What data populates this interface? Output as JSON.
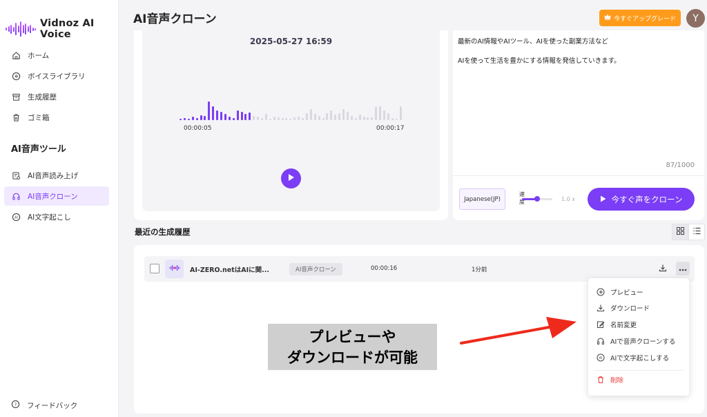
{
  "app": {
    "name": "Vidnoz AI Voice"
  },
  "sidebar": {
    "items": [
      {
        "label": "ホーム",
        "icon": "home-icon"
      },
      {
        "label": "ボイスライブラリ",
        "icon": "voice-library-icon"
      },
      {
        "label": "生成履歴",
        "icon": "history-icon"
      },
      {
        "label": "ゴミ箱",
        "icon": "trash-icon"
      }
    ],
    "section_title": "AI音声ツール",
    "tools": [
      {
        "label": "AI音声読み上げ",
        "icon": "text-to-speech-icon"
      },
      {
        "label": "AI音声クローン",
        "icon": "voice-clone-icon",
        "active": true
      },
      {
        "label": "AI文字起こし",
        "icon": "transcribe-icon"
      }
    ],
    "feedback_label": "フィードバック"
  },
  "header": {
    "title": "AI音声クローン",
    "upgrade_label": "今すぐアップグレード",
    "avatar_initial": "Y"
  },
  "player": {
    "date": "2025-05-27 16:59",
    "time_start": "00:00:05",
    "time_end": "00:00:17",
    "progress": 0.32,
    "played_color": "#7b3df5",
    "unplayed_color": "#d8d8e0"
  },
  "text_panel": {
    "lines": [
      "最新のAI情報やAIツール、AIを使った副業方法など",
      "AIを使って生活を豊かにする情報を発信していきます。"
    ],
    "char_count": "87/1000"
  },
  "controls": {
    "language": "Japanese(JP)",
    "speed_label": "速度",
    "speed_value": "1.0 x",
    "speed_level": 0.5,
    "clone_button_label": "今すぐ声をクローン"
  },
  "history": {
    "title": "最近の生成履歴",
    "rows": [
      {
        "name": "AI-ZERO.netはAIに関...",
        "tag": "AI音声クローン",
        "duration": "00:00:16",
        "time_ago": "1分前"
      }
    ]
  },
  "menu": {
    "items": [
      {
        "label": "プレビュー",
        "icon": "preview-icon"
      },
      {
        "label": "ダウンロード",
        "icon": "download-icon"
      },
      {
        "label": "名前変更",
        "icon": "rename-icon"
      },
      {
        "label": "AIで音声クローンする",
        "icon": "voice-clone-icon"
      },
      {
        "label": "AIで文字起こしする",
        "icon": "transcribe-icon"
      }
    ],
    "delete_label": "削除"
  },
  "annotation": {
    "line1": "プレビューや",
    "line2": "ダウンロードが可能",
    "arrow_color": "#ee2a1c"
  },
  "colors": {
    "accent": "#7b3df5",
    "upgrade": "#ff9b1a",
    "danger": "#e53935"
  }
}
